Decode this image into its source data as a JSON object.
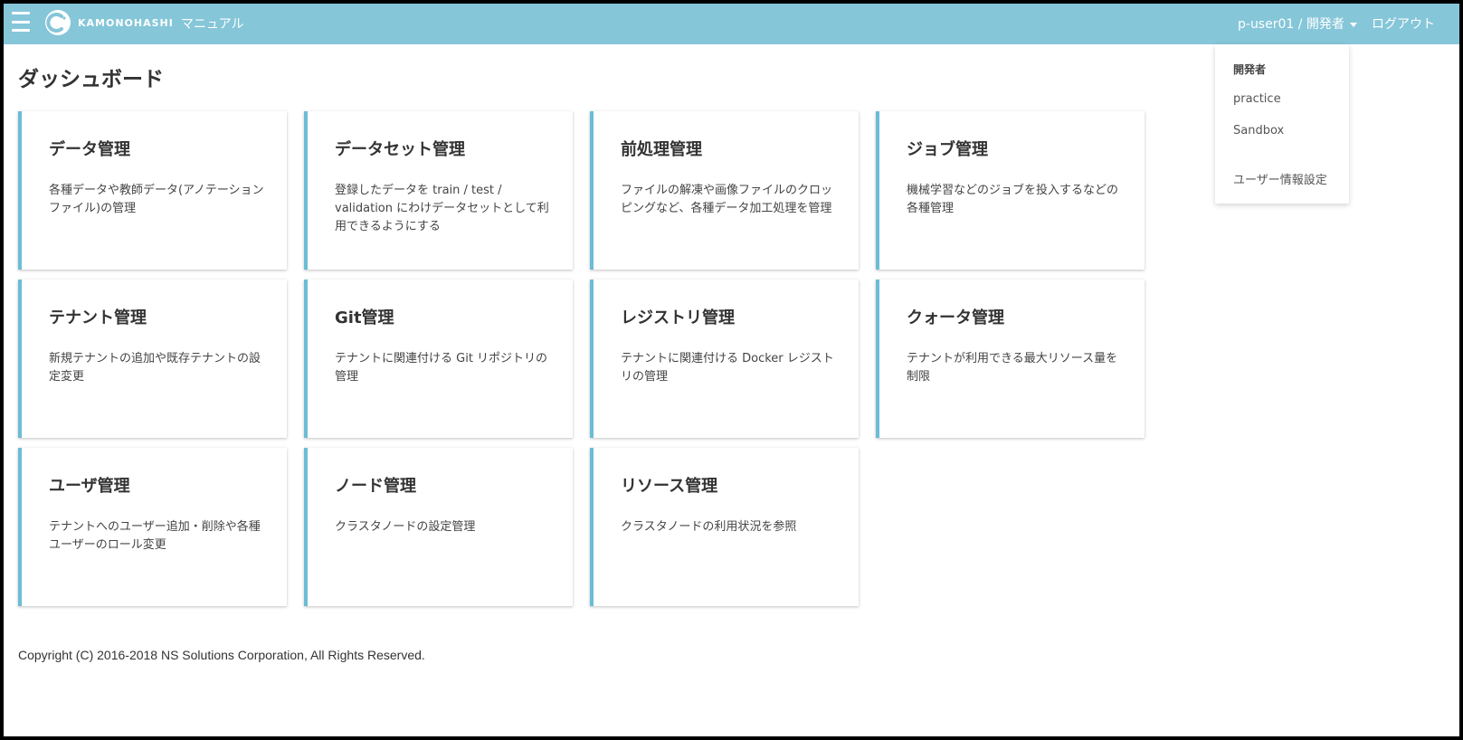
{
  "navbar": {
    "brand": "KAMONOHASHI",
    "manual_label": "マニュアル",
    "user_label": "p-user01 / 開発者",
    "logout_label": "ログアウト",
    "bar_color": "#85c6d9"
  },
  "page": {
    "title": "ダッシュボード"
  },
  "cards": [
    {
      "title": "データ管理",
      "desc": "各種データや教師データ(アノテーションファイル)の管理"
    },
    {
      "title": "データセット管理",
      "desc": "登録したデータを train / test / validation にわけデータセットとして利用できるようにする"
    },
    {
      "title": "前処理管理",
      "desc": "ファイルの解凍や画像ファイルのクロッピングなど、各種データ加工処理を管理"
    },
    {
      "title": "ジョブ管理",
      "desc": "機械学習などのジョブを投入するなどの各種管理"
    },
    {
      "title": "テナント管理",
      "desc": "新規テナントの追加や既存テナントの設定変更"
    },
    {
      "title": "Git管理",
      "desc": "テナントに関連付ける Git リポジトリの管理"
    },
    {
      "title": "レジストリ管理",
      "desc": "テナントに関連付ける Docker レジストリの管理"
    },
    {
      "title": "クォータ管理",
      "desc": "テナントが利用できる最大リソース量を制限"
    },
    {
      "title": "ユーザ管理",
      "desc": "テナントへのユーザー追加・削除や各種ユーザーのロール変更"
    },
    {
      "title": "ノード管理",
      "desc": "クラスタノードの設定管理"
    },
    {
      "title": "リソース管理",
      "desc": "クラスタノードの利用状況を参照"
    }
  ],
  "dropdown": {
    "header": "開発者",
    "items": [
      "practice",
      "Sandbox"
    ],
    "settings_label": "ユーザー情報設定"
  },
  "footer": {
    "copyright": "Copyright (C) 2016-2018 NS Solutions Corporation, All Rights Reserved."
  },
  "accent_color": "#6cbcd5"
}
